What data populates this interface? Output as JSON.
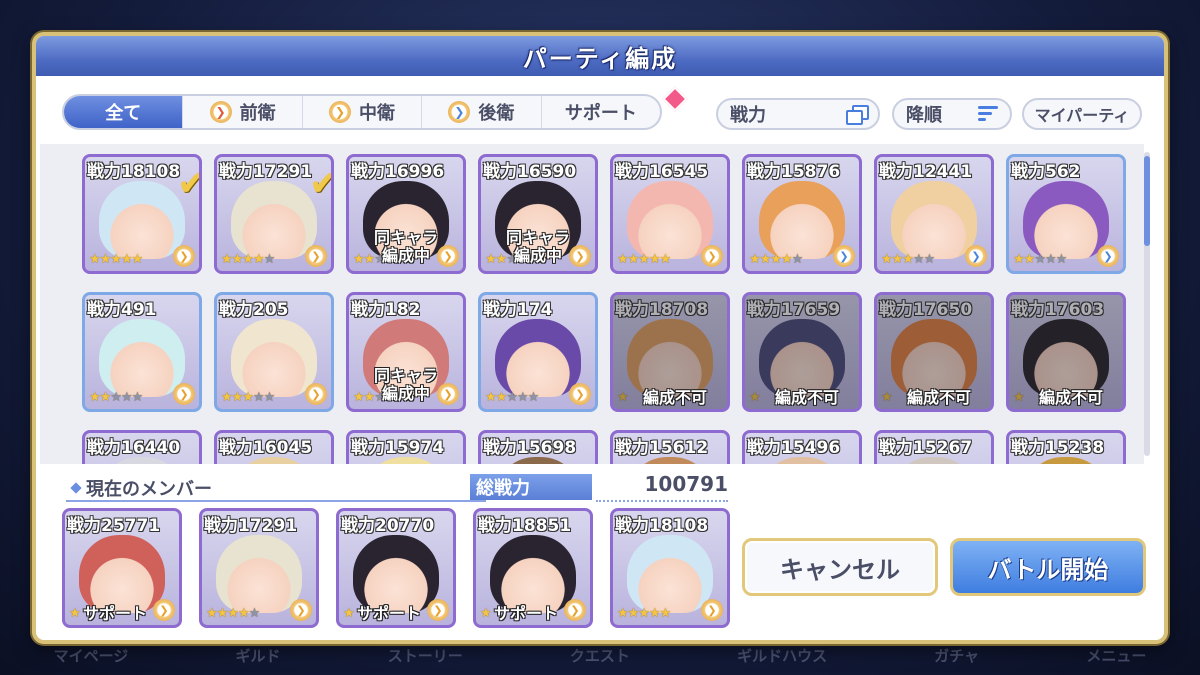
{
  "dialog": {
    "title": "パーティ編成"
  },
  "tabs": [
    {
      "label": "全て",
      "active": true
    },
    {
      "label": "前衛",
      "icon": "front-position-icon"
    },
    {
      "label": "中衛",
      "icon": "middle-position-icon"
    },
    {
      "label": "後衛",
      "icon": "back-position-icon"
    },
    {
      "label": "サポート",
      "icon": "support-gem-icon"
    }
  ],
  "controls": {
    "filter_label": "戦力",
    "sort_label": "降順",
    "my_party_label": "マイパーティ"
  },
  "roster": [
    {
      "power": "戦力18108",
      "stars": 5,
      "max": 5,
      "checked": true,
      "hair": "#cfe6f5"
    },
    {
      "power": "戦力17291",
      "stars": 4,
      "max": 5,
      "checked": true,
      "hair": "#e8e2d0"
    },
    {
      "power": "戦力16996",
      "stars": 2,
      "max": 5,
      "overlay": "同キャラ\n編成中",
      "hair": "#2a2430"
    },
    {
      "power": "戦力16590",
      "stars": 2,
      "max": 5,
      "overlay": "同キャラ\n編成中",
      "hair": "#2a2430"
    },
    {
      "power": "戦力16545",
      "stars": 5,
      "max": 5,
      "hair": "#f4b7b0"
    },
    {
      "power": "戦力15876",
      "stars": 4,
      "max": 5,
      "hair": "#e8a05a"
    },
    {
      "power": "戦力12441",
      "stars": 3,
      "max": 5,
      "hair": "#f0d0a0"
    },
    {
      "power": "戦力562",
      "stars": 2,
      "max": 5,
      "hair": "#8a5ac0"
    },
    {
      "power": "戦力491",
      "stars": 2,
      "max": 5,
      "hair": "#cfeef0"
    },
    {
      "power": "戦力205",
      "stars": 3,
      "max": 5,
      "hair": "#f0e6d0"
    },
    {
      "power": "戦力182",
      "stars": 2,
      "max": 5,
      "overlay": "同キャラ\n編成中",
      "hair": "#d07a7a"
    },
    {
      "power": "戦力174",
      "stars": 2,
      "max": 5,
      "hair": "#6a4aa8"
    },
    {
      "power": "戦力18708",
      "stars": 1,
      "max": 1,
      "low": "編成不可",
      "hair": "#e0a060"
    },
    {
      "power": "戦力17659",
      "stars": 1,
      "max": 1,
      "low": "編成不可",
      "hair": "#4a4a7a"
    },
    {
      "power": "戦力17650",
      "stars": 1,
      "max": 1,
      "low": "編成不可",
      "hair": "#e08040"
    },
    {
      "power": "戦力17603",
      "stars": 1,
      "max": 1,
      "low": "編成不可",
      "hair": "#2a2428"
    },
    {
      "power": "戦力16440",
      "hair": "#d8d8e0"
    },
    {
      "power": "戦力16045",
      "hair": "#e8d0a0"
    },
    {
      "power": "戦力15974",
      "hair": "#f0e0a0"
    },
    {
      "power": "戦力15698",
      "hair": "#8a6a4a"
    },
    {
      "power": "戦力15612",
      "hair": "#c08a5a"
    },
    {
      "power": "戦力15496",
      "hair": "#e0c0a0"
    },
    {
      "power": "戦力15267",
      "hair": "#d0c8c0"
    },
    {
      "power": "戦力15238",
      "hair": "#c89a40"
    }
  ],
  "members": {
    "header": "現在のメンバー",
    "total_label": "総戦力",
    "total_value": "100791",
    "list": [
      {
        "power": "戦力25771",
        "support": "サポート",
        "hair": "#d0605a"
      },
      {
        "power": "戦力17291",
        "stars": 4,
        "max": 5,
        "hair": "#e8e2d0"
      },
      {
        "power": "戦力20770",
        "support": "サポート",
        "hair": "#2a2430"
      },
      {
        "power": "戦力18851",
        "support": "サポート",
        "hair": "#2a2430"
      },
      {
        "power": "戦力18108",
        "stars": 5,
        "max": 5,
        "hair": "#cfe6f5"
      }
    ]
  },
  "buttons": {
    "cancel": "キャンセル",
    "battle": "バトル開始"
  },
  "background_nav": [
    "マイページ",
    "ギルド",
    "ストーリー",
    "クエスト",
    "ギルドハウス",
    "ガチャ",
    "メニュー"
  ]
}
